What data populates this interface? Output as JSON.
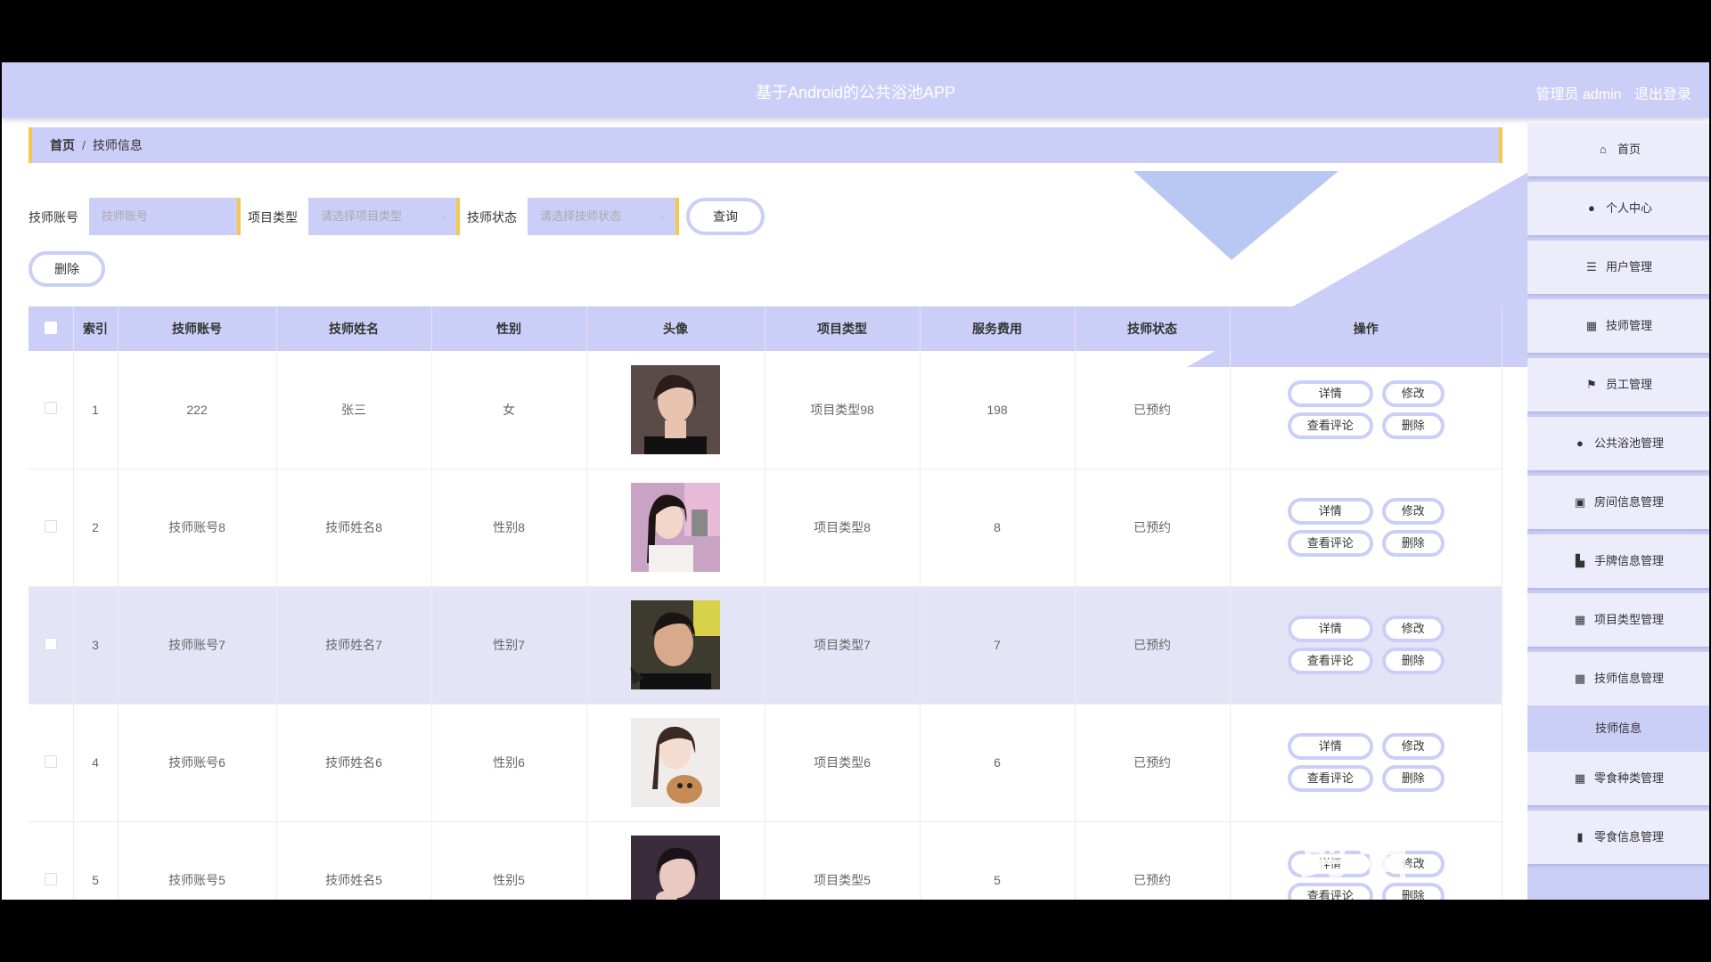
{
  "header": {
    "title": "基于Android的公共浴池APP",
    "user": "管理员 admin",
    "logout": "退出登录"
  },
  "breadcrumb": {
    "home": "首页",
    "current": "技师信息"
  },
  "search": {
    "account_label": "技师账号",
    "account_placeholder": "技师账号",
    "type_label": "项目类型",
    "type_placeholder": "请选择项目类型",
    "status_label": "技师状态",
    "status_placeholder": "请选择技师状态",
    "query_btn": "查询"
  },
  "delete_btn": "删除",
  "table": {
    "headers": [
      "索引",
      "技师账号",
      "技师姓名",
      "性别",
      "头像",
      "项目类型",
      "服务费用",
      "技师状态",
      "操作"
    ],
    "rows": [
      {
        "index": "1",
        "account": "222",
        "name": "张三",
        "gender": "女",
        "type": "项目类型98",
        "fee": "198",
        "status": "已预约"
      },
      {
        "index": "2",
        "account": "技师账号8",
        "name": "技师姓名8",
        "gender": "性别8",
        "type": "项目类型8",
        "fee": "8",
        "status": "已预约"
      },
      {
        "index": "3",
        "account": "技师账号7",
        "name": "技师姓名7",
        "gender": "性别7",
        "type": "项目类型7",
        "fee": "7",
        "status": "已预约"
      },
      {
        "index": "4",
        "account": "技师账号6",
        "name": "技师姓名6",
        "gender": "性别6",
        "type": "项目类型6",
        "fee": "6",
        "status": "已预约"
      },
      {
        "index": "5",
        "account": "技师账号5",
        "name": "技师姓名5",
        "gender": "性别5",
        "type": "项目类型5",
        "fee": "5",
        "status": "已预约"
      }
    ],
    "ops": {
      "detail": "详情",
      "edit": "修改",
      "comments": "查看评论",
      "delete": "删除"
    }
  },
  "sidebar": {
    "items": [
      {
        "label": "首页",
        "icon": "home-icon"
      },
      {
        "label": "个人中心",
        "icon": "user-icon"
      },
      {
        "label": "用户管理",
        "icon": "list-icon"
      },
      {
        "label": "技师管理",
        "icon": "grid-icon"
      },
      {
        "label": "员工管理",
        "icon": "flag-icon"
      },
      {
        "label": "公共浴池管理",
        "icon": "user-icon"
      },
      {
        "label": "房间信息管理",
        "icon": "clipboard-icon"
      },
      {
        "label": "手牌信息管理",
        "icon": "chart-icon"
      },
      {
        "label": "项目类型管理",
        "icon": "grid-icon"
      },
      {
        "label": "技师信息管理",
        "icon": "grid-icon"
      },
      {
        "label": "技师信息",
        "icon": ""
      },
      {
        "label": "零食种类管理",
        "icon": "grid-icon"
      },
      {
        "label": "零食信息管理",
        "icon": "bookmark-icon"
      }
    ]
  },
  "watermark": "剪辑",
  "colors": {
    "accent": "#cbcff7",
    "border_accent": "#f5c84c"
  }
}
